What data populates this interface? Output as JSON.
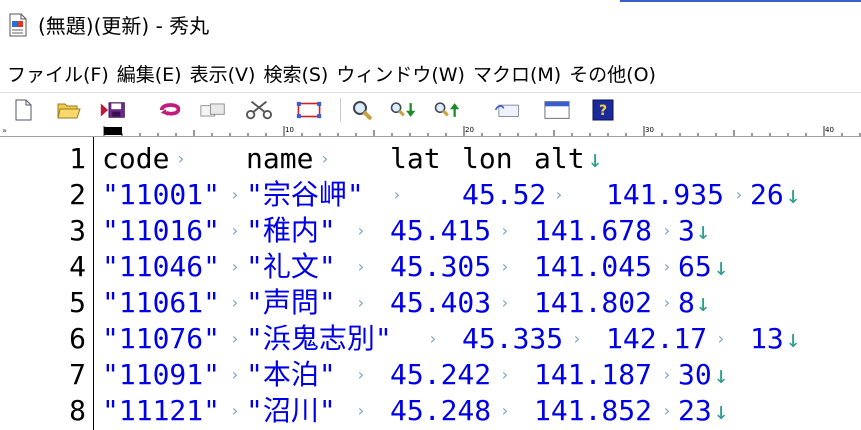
{
  "window": {
    "title": "(無題)(更新) - 秀丸",
    "accent_color": "#3a5fcd"
  },
  "menu": {
    "items": [
      {
        "label": "ファイル(F)"
      },
      {
        "label": "編集(E)"
      },
      {
        "label": "表示(V)"
      },
      {
        "label": "検索(S)"
      },
      {
        "label": "ウィンドウ(W)"
      },
      {
        "label": "マクロ(M)"
      },
      {
        "label": "その他(O)"
      }
    ]
  },
  "toolbar": {
    "icons": [
      "new-file-icon",
      "open-folder-icon",
      "save-icon",
      "undo-icon",
      "copy-icon",
      "cut-icon",
      "paste-icon",
      "find-icon",
      "find-down-icon",
      "find-up-icon",
      "grep-icon",
      "window-icon",
      "help-icon"
    ]
  },
  "ruler": {
    "labels": [
      "10",
      "20",
      "30",
      "40"
    ]
  },
  "editor": {
    "text_color": "#0000e6",
    "lines": [
      {
        "num": "1",
        "segments": [
          {
            "text": "code",
            "color": "black",
            "col": 0,
            "tab": true
          },
          {
            "text": "name",
            "color": "black",
            "col": 8,
            "tab": true
          },
          {
            "text": "lat",
            "color": "black",
            "col": 16,
            "tab": false
          },
          {
            "text": "lon",
            "color": "black",
            "col": 20,
            "tab": false
          },
          {
            "text": "alt",
            "color": "black",
            "col": 24,
            "tab": false
          }
        ],
        "eol_col": 27
      },
      {
        "num": "2",
        "segments": [
          {
            "text": "\"11001\"",
            "color": "blue",
            "col": 0,
            "tab": true
          },
          {
            "text": "\"宗谷岬\"",
            "color": "blue",
            "col": 8,
            "tab": true
          },
          {
            "text": "45.52",
            "color": "blue",
            "col": 20,
            "tab": true
          },
          {
            "text": "141.935",
            "color": "blue",
            "col": 28,
            "tab": true
          },
          {
            "text": "26",
            "color": "blue",
            "col": 36,
            "tab": false
          }
        ],
        "eol_col": 38
      },
      {
        "num": "3",
        "segments": [
          {
            "text": "\"11016\"",
            "color": "blue",
            "col": 0,
            "tab": true
          },
          {
            "text": "\"稚内\"",
            "color": "blue",
            "col": 8,
            "tab": true
          },
          {
            "text": "45.415",
            "color": "blue",
            "col": 16,
            "tab": true
          },
          {
            "text": "141.678",
            "color": "blue",
            "col": 24,
            "tab": true
          },
          {
            "text": "3",
            "color": "blue",
            "col": 32,
            "tab": false
          }
        ],
        "eol_col": 33
      },
      {
        "num": "4",
        "segments": [
          {
            "text": "\"11046\"",
            "color": "blue",
            "col": 0,
            "tab": true
          },
          {
            "text": "\"礼文\"",
            "color": "blue",
            "col": 8,
            "tab": true
          },
          {
            "text": "45.305",
            "color": "blue",
            "col": 16,
            "tab": true
          },
          {
            "text": "141.045",
            "color": "blue",
            "col": 24,
            "tab": true
          },
          {
            "text": "65",
            "color": "blue",
            "col": 32,
            "tab": false
          }
        ],
        "eol_col": 34
      },
      {
        "num": "5",
        "segments": [
          {
            "text": "\"11061\"",
            "color": "blue",
            "col": 0,
            "tab": true
          },
          {
            "text": "\"声問\"",
            "color": "blue",
            "col": 8,
            "tab": true
          },
          {
            "text": "45.403",
            "color": "blue",
            "col": 16,
            "tab": true
          },
          {
            "text": "141.802",
            "color": "blue",
            "col": 24,
            "tab": true
          },
          {
            "text": "8",
            "color": "blue",
            "col": 32,
            "tab": false
          }
        ],
        "eol_col": 33
      },
      {
        "num": "6",
        "segments": [
          {
            "text": "\"11076\"",
            "color": "blue",
            "col": 0,
            "tab": true
          },
          {
            "text": "\"浜鬼志別\"",
            "color": "blue",
            "col": 8,
            "tab": true
          },
          {
            "text": "45.335",
            "color": "blue",
            "col": 20,
            "tab": true
          },
          {
            "text": "142.17",
            "color": "blue",
            "col": 28,
            "tab": true
          },
          {
            "text": "13",
            "color": "blue",
            "col": 36,
            "tab": false
          }
        ],
        "eol_col": 38
      },
      {
        "num": "7",
        "segments": [
          {
            "text": "\"11091\"",
            "color": "blue",
            "col": 0,
            "tab": true
          },
          {
            "text": "\"本泊\"",
            "color": "blue",
            "col": 8,
            "tab": true
          },
          {
            "text": "45.242",
            "color": "blue",
            "col": 16,
            "tab": true
          },
          {
            "text": "141.187",
            "color": "blue",
            "col": 24,
            "tab": true
          },
          {
            "text": "30",
            "color": "blue",
            "col": 32,
            "tab": false
          }
        ],
        "eol_col": 34
      },
      {
        "num": "8",
        "segments": [
          {
            "text": "\"11121\"",
            "color": "blue",
            "col": 0,
            "tab": true
          },
          {
            "text": "\"沼川\"",
            "color": "blue",
            "col": 8,
            "tab": true
          },
          {
            "text": "45.248",
            "color": "blue",
            "col": 16,
            "tab": true
          },
          {
            "text": "141.852",
            "color": "blue",
            "col": 24,
            "tab": true
          },
          {
            "text": "23",
            "color": "blue",
            "col": 32,
            "tab": false
          }
        ],
        "eol_col": 34
      }
    ]
  }
}
